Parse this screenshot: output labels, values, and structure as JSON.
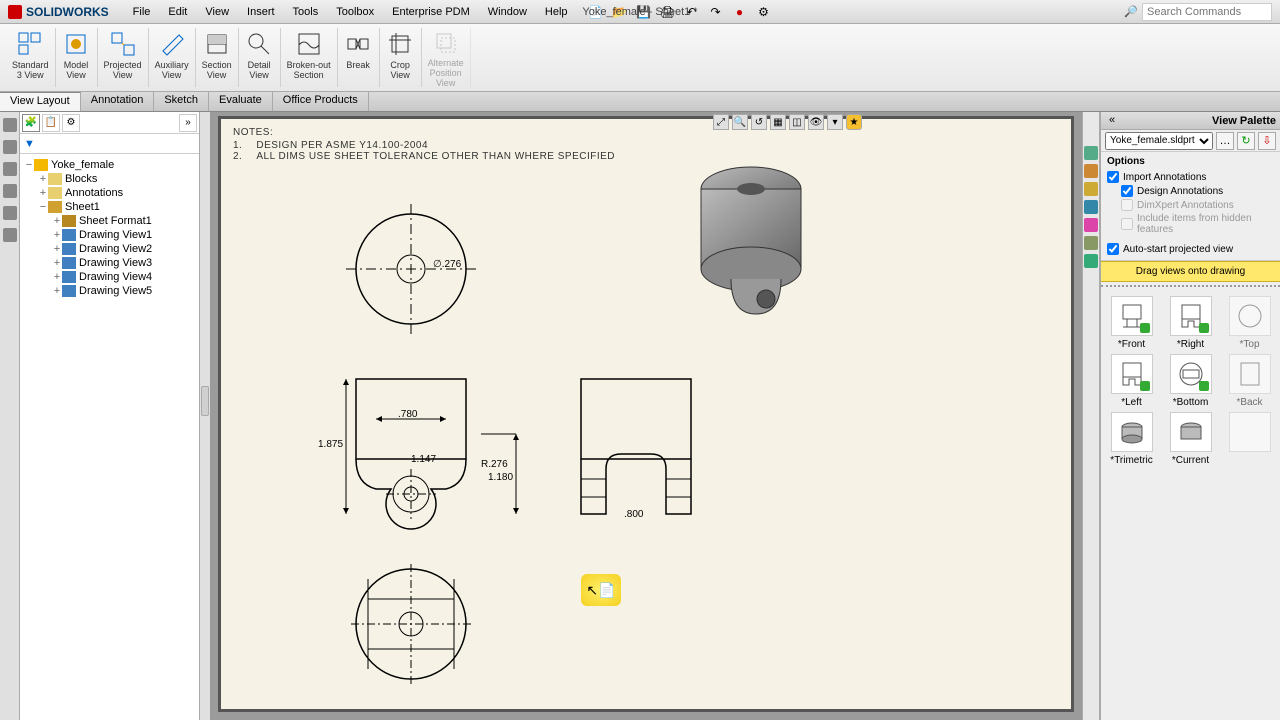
{
  "app": {
    "name": "SOLIDWORKS",
    "doc_title": "Yoke_female - Sheet1 *",
    "search_placeholder": "Search Commands"
  },
  "menus": [
    "File",
    "Edit",
    "View",
    "Insert",
    "Tools",
    "Toolbox",
    "Enterprise PDM",
    "Window",
    "Help"
  ],
  "ribbon": [
    {
      "label": "Standard\n3 View"
    },
    {
      "label": "Model\nView"
    },
    {
      "label": "Projected\nView"
    },
    {
      "label": "Auxiliary\nView"
    },
    {
      "label": "Section\nView"
    },
    {
      "label": "Detail\nView"
    },
    {
      "label": "Broken-out\nSection"
    },
    {
      "label": "Break"
    },
    {
      "label": "Crop\nView"
    },
    {
      "label": "Alternate\nPosition\nView",
      "disabled": true
    }
  ],
  "tabs": [
    "View Layout",
    "Annotation",
    "Sketch",
    "Evaluate",
    "Office Products"
  ],
  "active_tab": "View Layout",
  "tree": {
    "root": "Yoke_female",
    "blocks": "Blocks",
    "annotations": "Annotations",
    "sheet": "Sheet1",
    "sheet_format": "Sheet Format1",
    "views": [
      "Drawing View1",
      "Drawing View2",
      "Drawing View3",
      "Drawing View4",
      "Drawing View5"
    ]
  },
  "notes": {
    "title": "NOTES:",
    "l1": "DESIGN PER ASME Y14.100-2004",
    "l2": "ALL DIMS USE SHEET TOLERANCE OTHER THAN WHERE SPECIFIED"
  },
  "dims": {
    "top_dia": "∅.276",
    "front_w": ".780",
    "front_h": "1.875",
    "front_r": "1.147",
    "front_r2": "R.276",
    "front_d": "1.180",
    "right_w": ".800"
  },
  "palette": {
    "title": "View Palette",
    "file": "Yoke_female.sldprt",
    "options_hdr": "Options",
    "opt_import": "Import Annotations",
    "opt_design": "Design Annotations",
    "opt_dimx": "DimXpert Annotations",
    "opt_hidden": "Include items from hidden features",
    "opt_auto": "Auto-start projected view",
    "drag_hint": "Drag views onto drawing",
    "cells": [
      {
        "label": "*Front"
      },
      {
        "label": "*Right"
      },
      {
        "label": "*Top",
        "cut": true
      },
      {
        "label": "*Left"
      },
      {
        "label": "*Bottom"
      },
      {
        "label": "*Back",
        "cut": true
      },
      {
        "label": "*Trimetric"
      },
      {
        "label": "*Current"
      },
      {
        "label": "",
        "cut": true
      }
    ]
  }
}
